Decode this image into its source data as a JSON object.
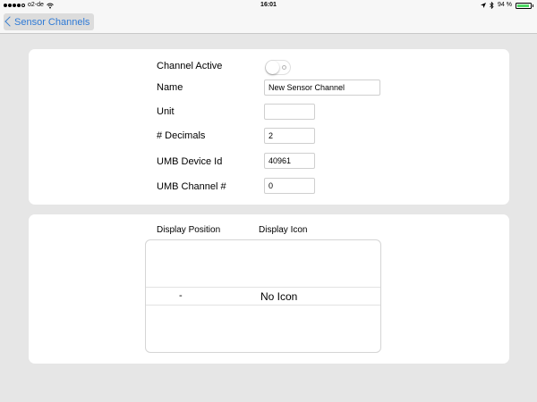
{
  "status_bar": {
    "carrier": "o2-de",
    "time": "16:01",
    "battery_text": "94 %",
    "battery_level": 0.94,
    "battery_color": "#4cd964",
    "icons": [
      "signal-dots",
      "wifi-icon",
      "location-icon",
      "bluetooth-icon",
      "battery-icon"
    ]
  },
  "nav": {
    "back_label": "Sensor Channels",
    "accent": "#2f7ad6"
  },
  "form": {
    "channel_active_label": "Channel Active",
    "channel_active": false,
    "name_label": "Name",
    "name_value": "New Sensor Channel",
    "unit_label": "Unit",
    "unit_value": "",
    "decimals_label": "# Decimals",
    "decimals_value": "2",
    "device_id_label": "UMB Device Id",
    "device_id_value": "40961",
    "channel_label": "UMB Channel #",
    "channel_value": "0"
  },
  "display": {
    "position_header": "Display Position",
    "icon_header": "Display Icon",
    "rows": [
      {
        "position": "-",
        "icon": "No Icon"
      }
    ]
  }
}
